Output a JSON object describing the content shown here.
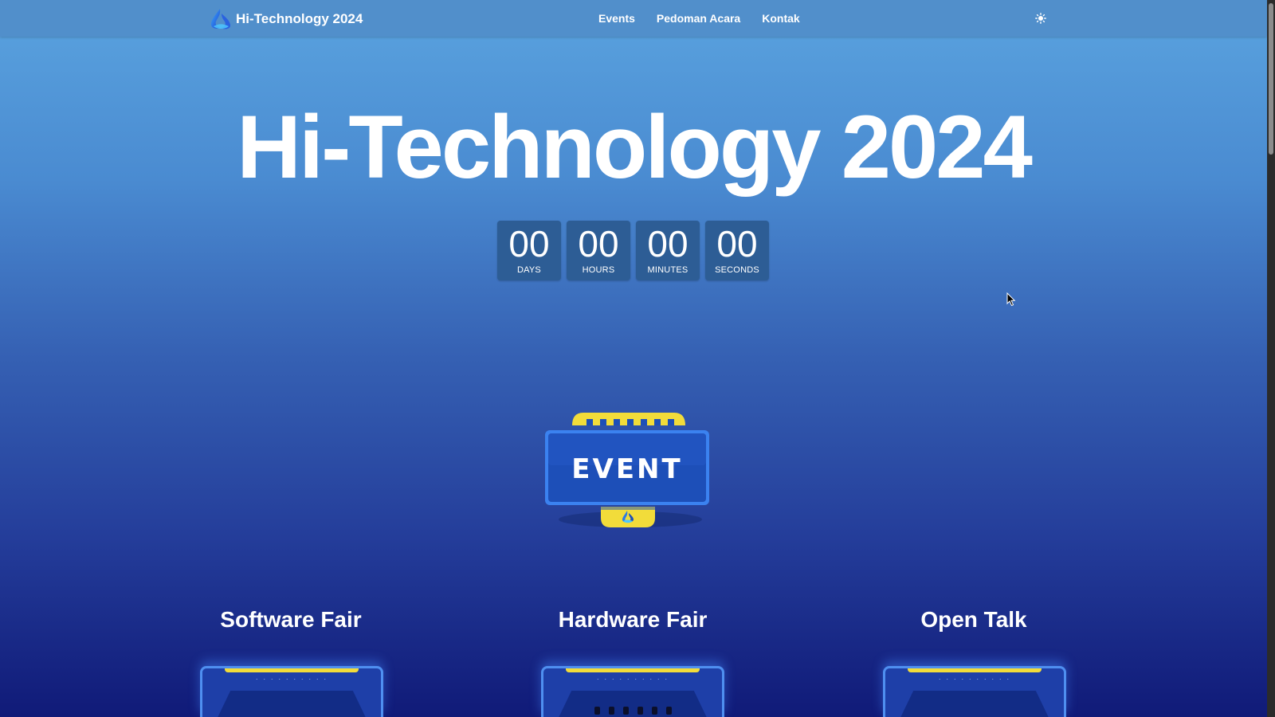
{
  "navbar": {
    "brand": "Hi-Technology 2024",
    "links": [
      "Events",
      "Pedoman Acara",
      "Kontak"
    ],
    "theme_icon": "sun-icon"
  },
  "hero": {
    "title": "Hi-Technology 2024",
    "countdown": [
      {
        "value": "00",
        "label": "DAYS"
      },
      {
        "value": "00",
        "label": "HOURS"
      },
      {
        "value": "00",
        "label": "MINUTES"
      },
      {
        "value": "00",
        "label": "SECONDS"
      }
    ]
  },
  "event_badge": {
    "label": "EVENT"
  },
  "sections": [
    {
      "title": "Software Fair",
      "dots": "· · · · · · · · · ·"
    },
    {
      "title": "Hardware Fair",
      "dots": "· · · · · · · · · ·"
    },
    {
      "title": "Open Talk",
      "dots": "· · · · · · · · · ·"
    }
  ],
  "colors": {
    "accent_yellow": "#f2dc3a",
    "badge_blue": "#1d4fb8",
    "countdown_box": "#2d5d95"
  }
}
